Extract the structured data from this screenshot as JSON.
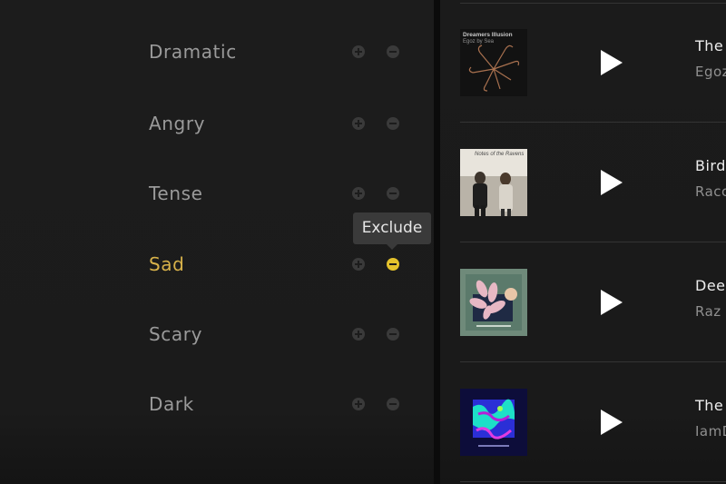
{
  "moods": [
    {
      "label": "Dramatic",
      "active": false
    },
    {
      "label": "Angry",
      "active": false
    },
    {
      "label": "Tense",
      "active": false
    },
    {
      "label": "Sad",
      "active": true
    },
    {
      "label": "Scary",
      "active": false
    },
    {
      "label": "Dark",
      "active": false
    }
  ],
  "tooltip": {
    "text": "Exclude"
  },
  "colors": {
    "accent": "#d8b24a",
    "exclude_active": "#e4c22c"
  },
  "tracks": [
    {
      "title": "The",
      "artist": "Egoz",
      "album_text_1": "Dreamers Illusion",
      "album_text_2": "Egoz by Sea"
    },
    {
      "title": "Bird",
      "artist": "Racc",
      "album_text_1": "Notes of the Ravens",
      "album_text_2": ""
    },
    {
      "title": "Dee",
      "artist": "Raz I",
      "album_text_1": "",
      "album_text_2": ""
    },
    {
      "title": "The",
      "artist": "IamD",
      "album_text_1": "",
      "album_text_2": ""
    }
  ]
}
